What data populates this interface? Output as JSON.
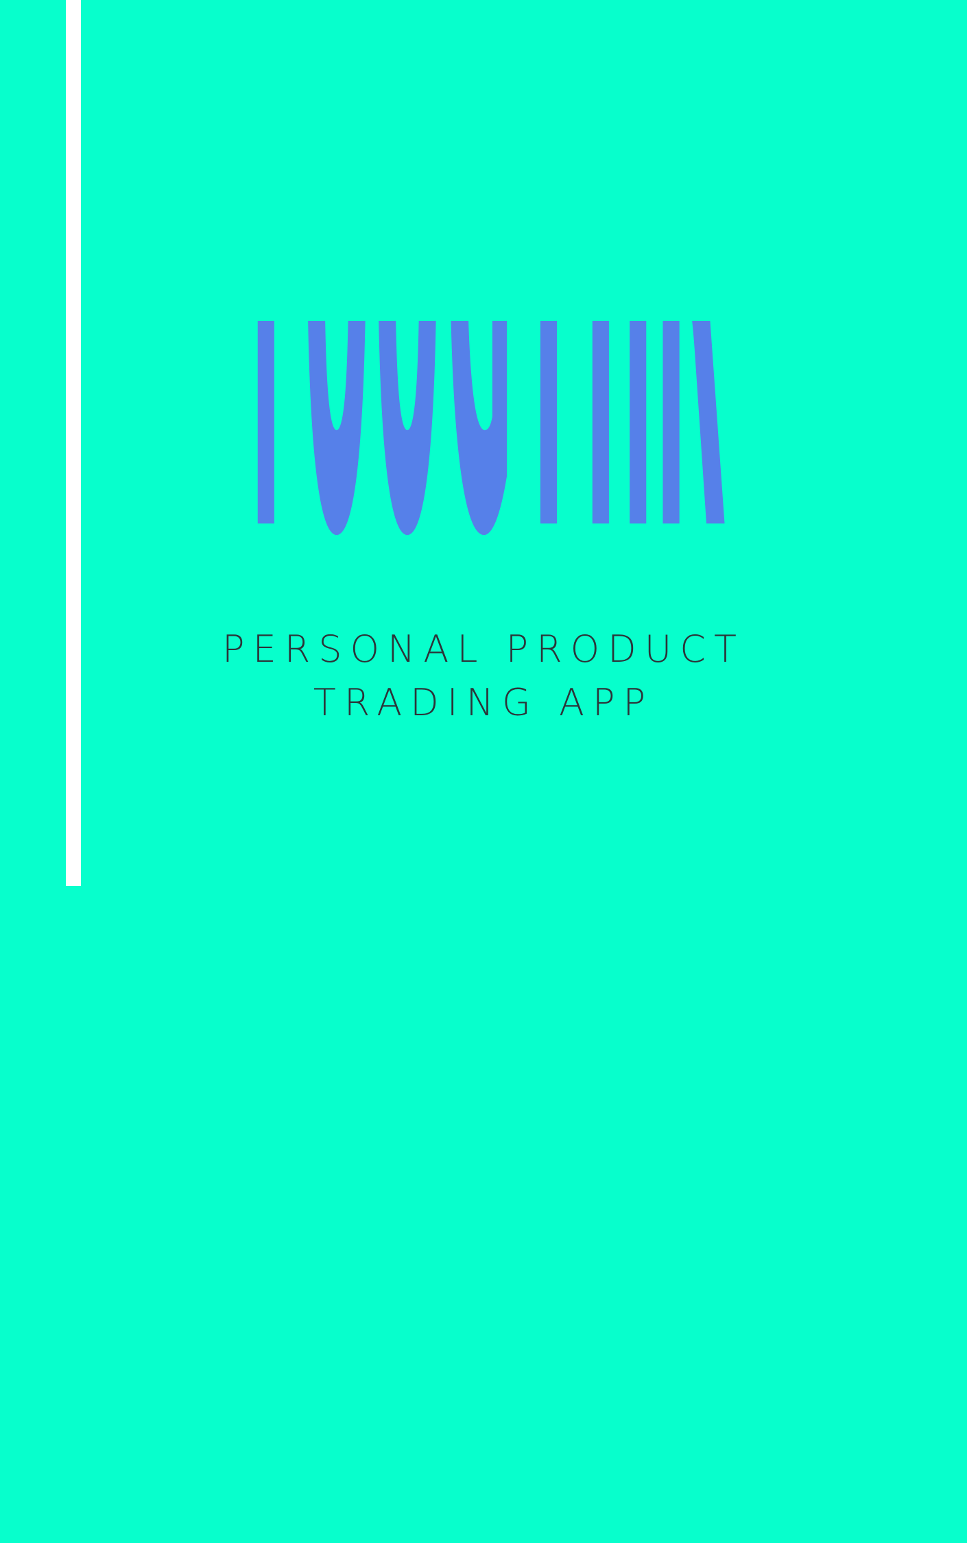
{
  "app": {
    "name": "TOOGTHR",
    "tagline": {
      "line1": "PERSONAL PRODUCT",
      "line2": "TRADING APP"
    }
  },
  "colors": {
    "background": "#07ffcc",
    "accent_bar": "#ffffff",
    "logo": "#5680e9",
    "tagline_text": "#2c3438"
  }
}
